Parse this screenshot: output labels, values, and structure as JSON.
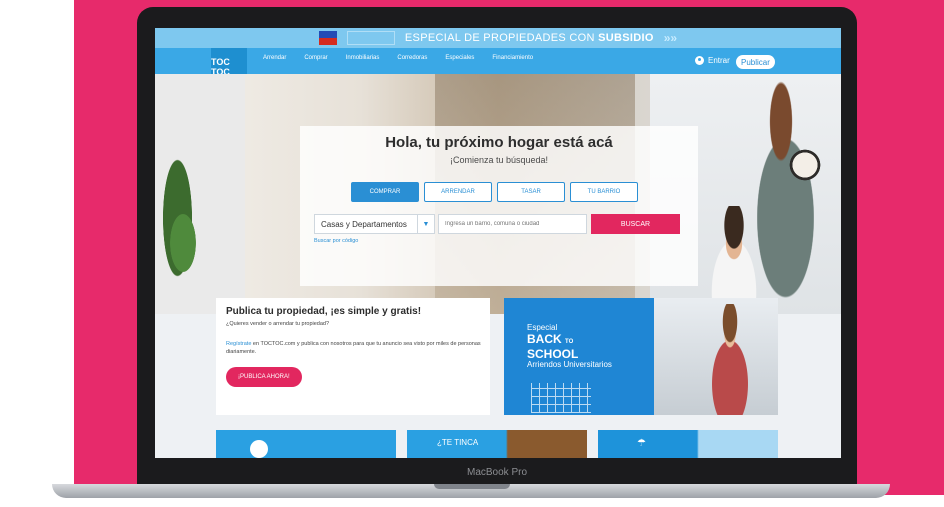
{
  "promo": {
    "text": "ESPECIAL DE PROPIEDADES CON",
    "bold": "SUBSIDIO",
    "arrows": "»»"
  },
  "logo": {
    "text": "TOC TOC"
  },
  "nav": {
    "links": [
      "Arrendar",
      "Comprar",
      "Inmobiliarias",
      "Corredoras",
      "Especiales",
      "Financiamiento"
    ]
  },
  "header": {
    "login_label": "Entrar",
    "publish_label": "Publicar"
  },
  "hero": {
    "title": "Hola, tu próximo hogar está acá",
    "subtitle": "¡Comienza tu búsqueda!",
    "tabs": [
      "COMPRAR",
      "ARRENDAR",
      "TASAR",
      "TU BARRIO"
    ],
    "active_tab": "COMPRAR",
    "property_type": "Casas y Departamentos",
    "search_placeholder": "Ingresa un barrio, comuna o ciudad",
    "search_button": "BUSCAR",
    "code_link": "Buscar por código"
  },
  "publish": {
    "title": "Publica tu propiedad, ¡es simple y gratis!",
    "question": "¿Quieres vender o arrendar tu propiedad?",
    "link": "Regístrate",
    "body": "en TOCTOC.com y publica con nosotros para que tu anuncio sea visto por miles de personas diariamente.",
    "button": "¡PUBLICA AHORA!"
  },
  "back_to_school": {
    "line1": "Especial",
    "line2": "BACK",
    "to": "TO",
    "line3": "SCHOOL",
    "line4": "Arriendos Universitarios"
  },
  "bottom": {
    "card2_text": "¿TE TINCA"
  },
  "device": {
    "label": "MacBook Pro"
  },
  "colors": {
    "pink": "#e72a6b",
    "blue": "#3aa8e6",
    "accent": "#e2275f"
  }
}
